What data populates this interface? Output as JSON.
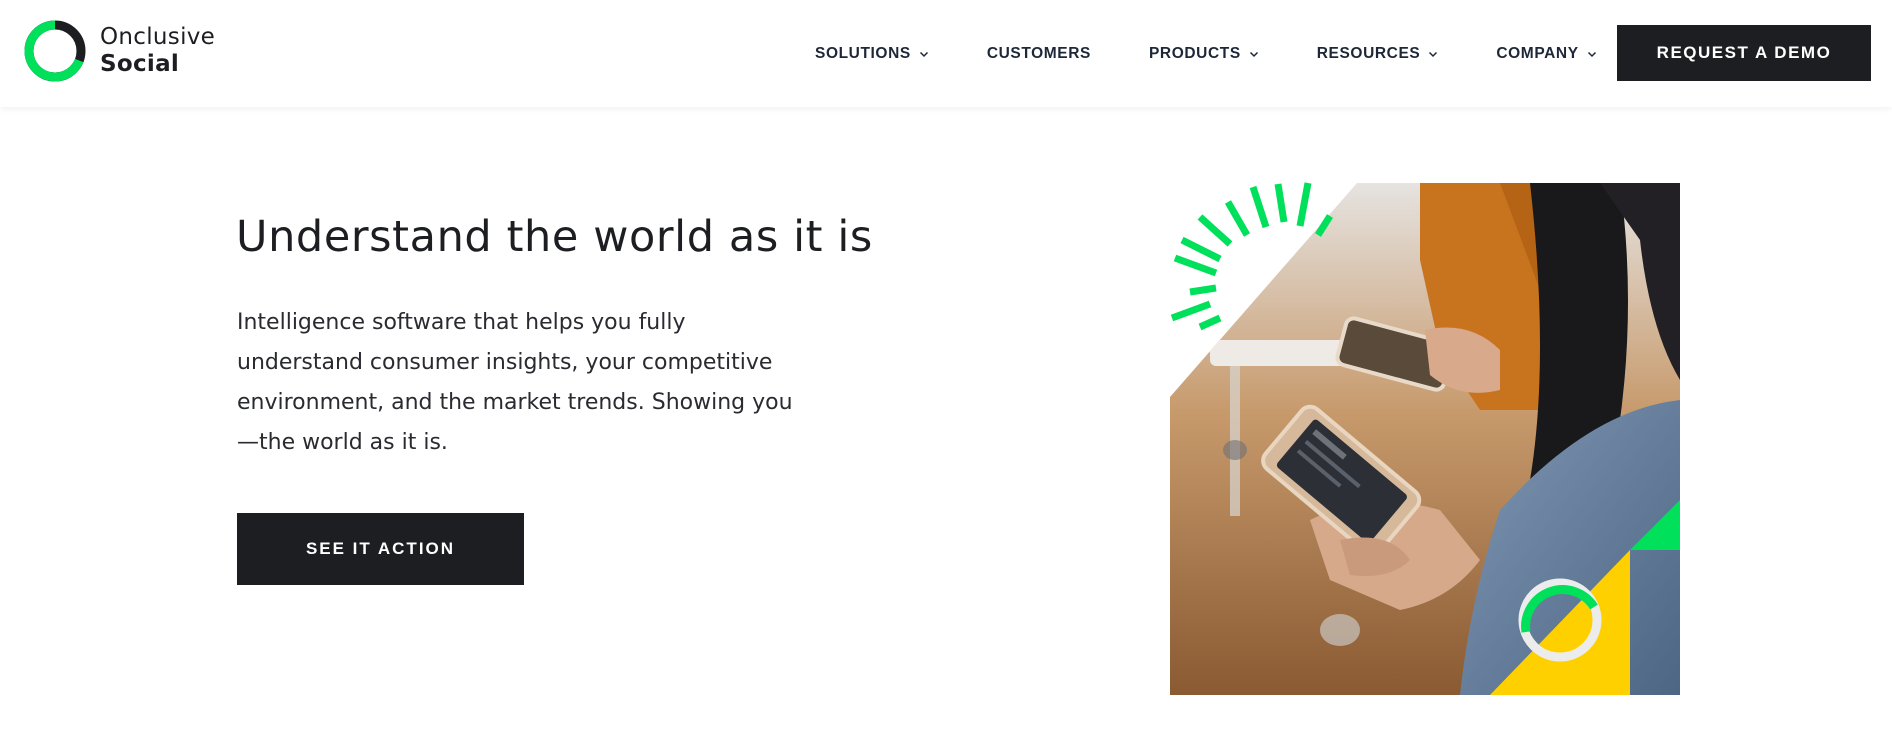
{
  "brand": {
    "name_line1": "Onclusive",
    "name_line2": "Social",
    "accent_color": "#00e05a",
    "dark_color": "#1d1e22",
    "yellow_color": "#ffd000"
  },
  "nav": {
    "items": [
      {
        "label": "SOLUTIONS",
        "has_dropdown": true
      },
      {
        "label": "CUSTOMERS",
        "has_dropdown": false
      },
      {
        "label": "PRODUCTS",
        "has_dropdown": true
      },
      {
        "label": "RESOURCES",
        "has_dropdown": true
      },
      {
        "label": "COMPANY",
        "has_dropdown": true
      }
    ],
    "demo_label": "REQUEST A DEMO"
  },
  "hero": {
    "title": "Understand the world as it is",
    "description": "Intelligence software that helps you fully understand consumer insights, your competitive environment, and the market trends. Showing you —the world as it is.",
    "cta_label": "SEE IT ACTION",
    "image_subject": "person holding a smartphone"
  },
  "icons": {
    "dropdown": "chevron-down-icon",
    "logo": "ring-logo-icon"
  }
}
